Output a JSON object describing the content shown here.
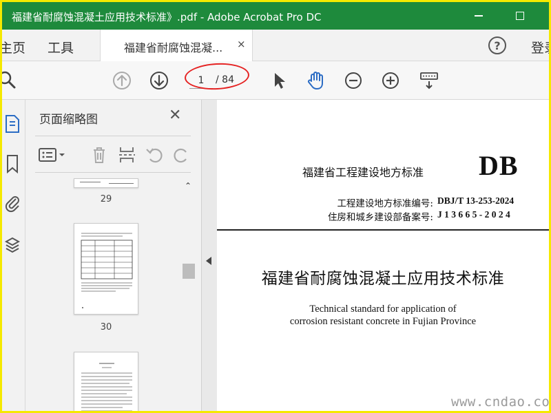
{
  "window": {
    "title": "福建省耐腐蚀混凝土应用技术标准》.pdf - Adobe Acrobat Pro DC"
  },
  "nav": {
    "home": "主页",
    "tools": "工具",
    "doc_tab": "福建省耐腐蚀混凝...",
    "doc_tab_close": "×",
    "help": "?",
    "login": "登录"
  },
  "toolbar": {
    "current_page": "1",
    "total_pages": "/ 84"
  },
  "thumbnails": {
    "title": "页面缩略图",
    "close": "✕",
    "pages": [
      {
        "label": "29"
      },
      {
        "label": "30"
      }
    ]
  },
  "document": {
    "standard_label": "福建省工程建设地方标准",
    "logo": "DB",
    "meta": [
      {
        "key": "工程建设地方标准编号:",
        "value": "DBJ/T 13-253-2024"
      },
      {
        "key": "住房和城乡建设部备案号:",
        "value": "J 1 3 6 6 5 - 2 0 2 4"
      }
    ],
    "title_cn": "福建省耐腐蚀混凝土应用技术标准",
    "title_en": [
      "Technical standard for application of",
      "corrosion resistant concrete in Fujian Province"
    ]
  },
  "watermark": "www.cndao.com",
  "colors": {
    "titlebar": "#1e8a3c",
    "frame": "#f5e900",
    "annotation": "#e52222",
    "hand_tool": "#2b6cc4"
  }
}
